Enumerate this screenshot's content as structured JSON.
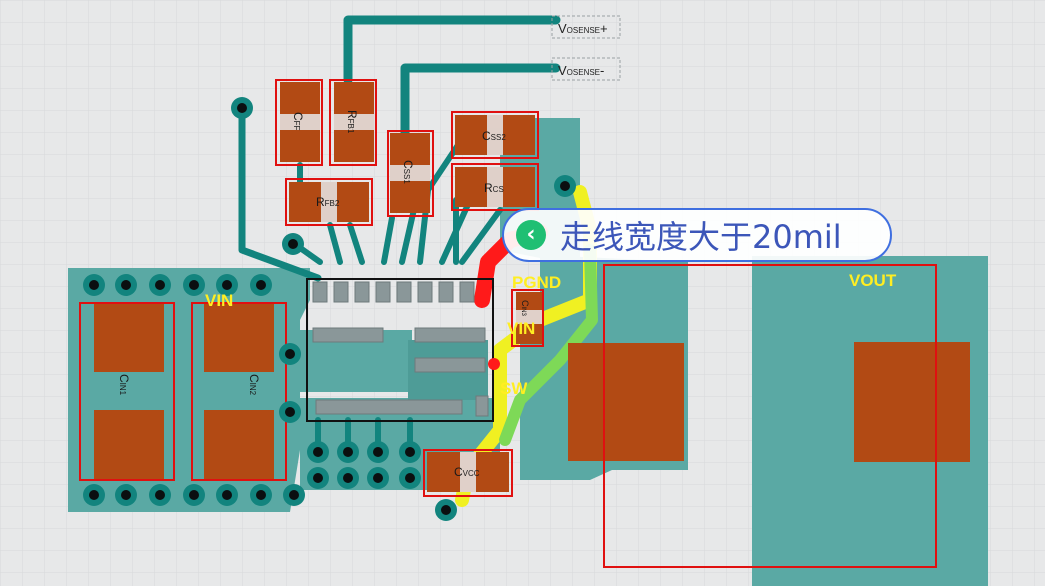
{
  "sense_labels": {
    "plus": {
      "main": "V",
      "sub": "OSENSE",
      "suffix": "+"
    },
    "minus": {
      "main": "V",
      "sub": "OSENSE",
      "suffix": "-"
    }
  },
  "components": {
    "cff": {
      "main": "C",
      "sub": "FF"
    },
    "rfb1": {
      "main": "R",
      "sub": "FB1"
    },
    "rfb2": {
      "main": "R",
      "sub": "FB2"
    },
    "css1": {
      "main": "C",
      "sub": "SS1"
    },
    "css2": {
      "main": "C",
      "sub": "SS2"
    },
    "rcs": {
      "main": "R",
      "sub": "CS"
    },
    "cin1": {
      "main": "C",
      "sub": "IN1"
    },
    "cin2": {
      "main": "C",
      "sub": "IN2"
    },
    "cin3": {
      "main": "C",
      "sub": "IN3"
    },
    "cvcc": {
      "main": "C",
      "sub": "VCC"
    }
  },
  "net_labels": {
    "vin_left": "VIN",
    "vin_right": "VIN",
    "pgnd": "PGND",
    "sw": "SW",
    "vout": "VOUT"
  },
  "callout": {
    "back_icon": "chevron-left-icon",
    "text": "走线宽度大于20mil"
  },
  "colors": {
    "background": "#e7e8e9",
    "copper_pour": "#5aa9a4",
    "trace": "#12847e",
    "pad": "#b24a14",
    "outline": "#e01010",
    "highlight_red": "#ff1a1a",
    "highlight_yellow": "#f0f022",
    "highlight_green": "#7ed957",
    "net_label": "#ffee22",
    "callout_border": "#3f6fe0",
    "callout_text": "#3c56b9"
  }
}
